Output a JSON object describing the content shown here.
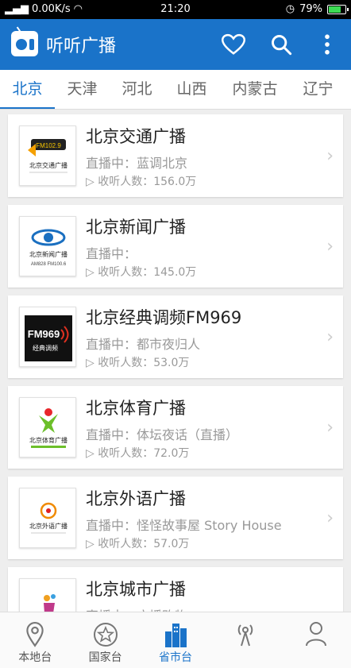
{
  "status_bar": {
    "network": "0.00K/s",
    "time": "21:20",
    "battery": "79%",
    "battery_level": 0.79
  },
  "app_bar": {
    "title": "听听广播",
    "icons": [
      "radio-icon",
      "heart-icon",
      "search-icon",
      "more-vert-icon"
    ]
  },
  "tabs": [
    {
      "label": "北京",
      "active": true
    },
    {
      "label": "天津",
      "active": false
    },
    {
      "label": "河北",
      "active": false
    },
    {
      "label": "山西",
      "active": false
    },
    {
      "label": "内蒙古",
      "active": false
    },
    {
      "label": "辽宁",
      "active": false
    }
  ],
  "stations": [
    {
      "name": "北京交通广播",
      "live": "直播中：蓝调北京",
      "listeners": "▷ 收听人数：156.0万",
      "logo_text": "FM102.9",
      "logo_sub": "北京交通广播"
    },
    {
      "name": "北京新闻广播",
      "live": "直播中：",
      "listeners": "▷ 收听人数：145.0万",
      "logo_text": "AM828 FM100.6",
      "logo_sub": "北京新闻广播"
    },
    {
      "name": "北京经典调频FM969",
      "live": "直播中：都市夜归人",
      "listeners": "▷ 收听人数：53.0万",
      "logo_text": "FM969",
      "logo_sub": "经典调频"
    },
    {
      "name": "北京体育广播",
      "live": "直播中：体坛夜话（直播）",
      "listeners": "▷ 收听人数：72.0万",
      "logo_text": "",
      "logo_sub": "北京体育广播"
    },
    {
      "name": "北京外语广播",
      "live": "直播中：怪怪故事屋 Story House",
      "listeners": "▷ 收听人数：57.0万",
      "logo_text": "",
      "logo_sub": "北京外语广播"
    },
    {
      "name": "北京城市广播",
      "live": "直播中：广播购物",
      "listeners": "",
      "logo_text": "",
      "logo_sub": ""
    }
  ],
  "bottom_nav": [
    {
      "label": "本地台",
      "icon": "location-pin-icon",
      "active": false
    },
    {
      "label": "国家台",
      "icon": "star-circle-icon",
      "active": false
    },
    {
      "label": "省市台",
      "icon": "city-buildings-icon",
      "active": true
    },
    {
      "label": "",
      "icon": "radio-tower-icon",
      "active": false
    },
    {
      "label": "",
      "icon": "person-icon",
      "active": false
    }
  ],
  "colors": {
    "primary": "#1a73c9",
    "background": "#eeeeee"
  }
}
